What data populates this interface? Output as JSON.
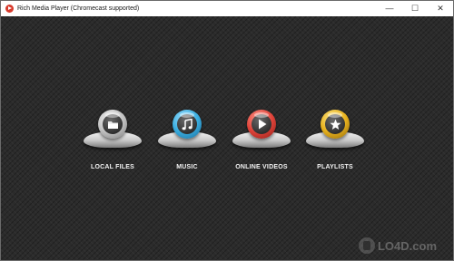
{
  "window": {
    "title": "Rich Media Player (Chromecast supported)",
    "controls": {
      "minimize": "—",
      "maximize": "☐",
      "close": "✕"
    }
  },
  "menu": {
    "items": [
      {
        "label": "LOCAL FILES",
        "icon": "folder-icon",
        "color": "#c8c8c8"
      },
      {
        "label": "MUSIC",
        "icon": "music-note-icon",
        "color": "#3fb0e0"
      },
      {
        "label": "ONLINE VIDEOS",
        "icon": "play-icon",
        "color": "#e0463c"
      },
      {
        "label": "PLAYLISTS",
        "icon": "star-icon",
        "color": "#e8b21e"
      }
    ]
  },
  "watermark": {
    "text": "LO4D.com"
  }
}
